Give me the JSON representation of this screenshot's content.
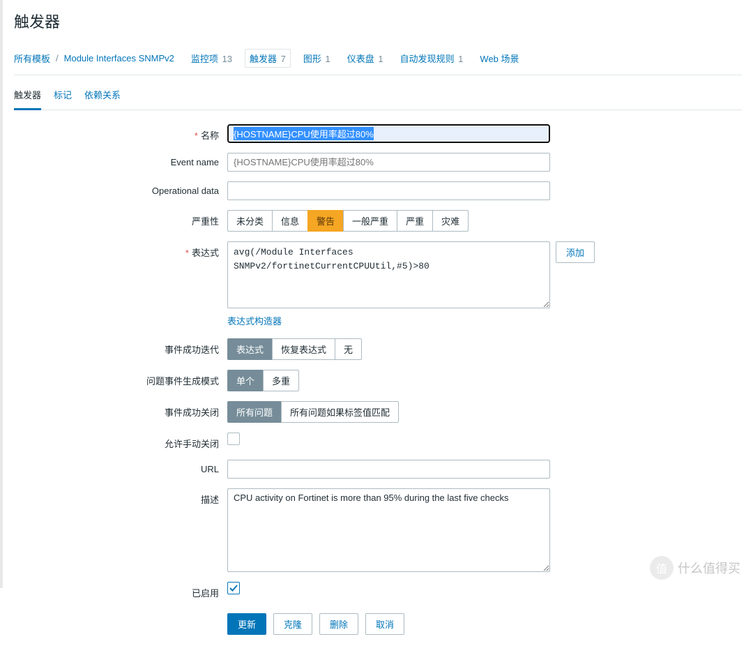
{
  "title": "触发器",
  "breadcrumb": {
    "all_templates": "所有模板",
    "template_name": "Module Interfaces SNMPv2",
    "items": [
      {
        "label": "监控项",
        "count": "13"
      },
      {
        "label": "触发器",
        "count": "7",
        "active": true
      },
      {
        "label": "图形",
        "count": "1"
      },
      {
        "label": "仪表盘",
        "count": "1"
      },
      {
        "label": "自动发现规则",
        "count": "1"
      },
      {
        "label": "Web 场景",
        "count": ""
      }
    ]
  },
  "tabs": {
    "trigger": "触发器",
    "tags": "标记",
    "deps": "依赖关系"
  },
  "labels": {
    "name": "名称",
    "event_name": "Event name",
    "op_data": "Operational data",
    "severity": "严重性",
    "expression": "表达式",
    "expr_builder": "表达式构造器",
    "ok_gen": "事件成功迭代",
    "problem_mode": "问题事件生成模式",
    "ok_close": "事件成功关闭",
    "allow_manual": "允许手动关闭",
    "url": "URL",
    "description": "描述",
    "enabled": "已启用",
    "add": "添加"
  },
  "values": {
    "name": "{HOSTNAME}CPU使用率超过80%",
    "event_name_ph": "{HOSTNAME}CPU使用率超过80%",
    "op_data": "",
    "expression": "avg(/Module Interfaces SNMPv2/fortinetCurrentCPUUtil,#5)>80",
    "url": "",
    "description": "CPU activity on Fortinet is more than 95% during the last five checks",
    "enabled": true
  },
  "severity": [
    "未分类",
    "信息",
    "警告",
    "一般严重",
    "严重",
    "灾难"
  ],
  "severity_selected": 2,
  "ok_gen": [
    "表达式",
    "恢复表达式",
    "无"
  ],
  "ok_gen_selected": 0,
  "problem_mode": [
    "单个",
    "多重"
  ],
  "problem_mode_selected": 0,
  "ok_close": [
    "所有问题",
    "所有问题如果标签值匹配"
  ],
  "ok_close_selected": 0,
  "buttons": {
    "update": "更新",
    "clone": "克隆",
    "delete": "删除",
    "cancel": "取消"
  },
  "watermark": {
    "badge": "值",
    "text": "什么值得买"
  }
}
